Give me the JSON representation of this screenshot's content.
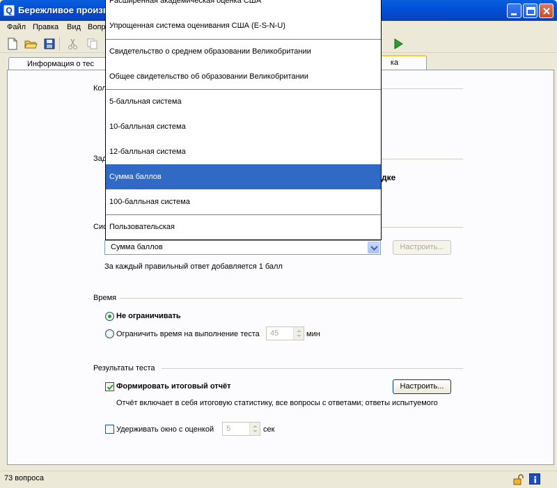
{
  "window": {
    "title": "Бережливое произв",
    "icon_letter": "Q"
  },
  "menu": [
    "Файл",
    "Правка",
    "Вид",
    "Вопр"
  ],
  "tabs": {
    "info": "Информация о тес",
    "active_tail": "ка"
  },
  "sections": {
    "kol_fragment": "Кол",
    "zad_fragment": "Зад",
    "zad_right_fragment": "дке",
    "sys_fragment": "Сис"
  },
  "grading": {
    "selected": "Сумма баллов",
    "configure_button": "Настроить...",
    "description": "За каждый правильный ответ добавляется 1 балл",
    "options": [
      "Расширенная академическая оценка США",
      "Упрощенная система оценивания США (E-S-N-U)",
      "Свидетельство о среднем образовании Великобритании",
      "Общее свидетельство об образовании Великобритании",
      "5-балльная система",
      "10-балльная система",
      "12-балльная система",
      "Сумма баллов",
      "100-балльная система",
      "Пользовательская"
    ]
  },
  "time": {
    "header": "Время",
    "unlimited": "Не ограничивать",
    "limit_label": "Ограничить время на выполнение теста",
    "limit_value": "45",
    "unit": "мин"
  },
  "results": {
    "header": "Результаты теста",
    "report_label": "Формировать итоговый отчёт",
    "report_checked": true,
    "configure_button": "Настроить...",
    "report_description": "Отчёт включает в себя итоговую статистику, все вопросы с ответами; ответы испытуемого",
    "hold_label": "Удерживать окно с оценкой",
    "hold_checked": false,
    "hold_value": "5",
    "hold_unit": "сек"
  },
  "status": {
    "questions": "73 вопроса"
  },
  "colors": {
    "title_bar": "#0846c4",
    "selection": "#316ac5",
    "run_green": "#2f9a2f"
  }
}
